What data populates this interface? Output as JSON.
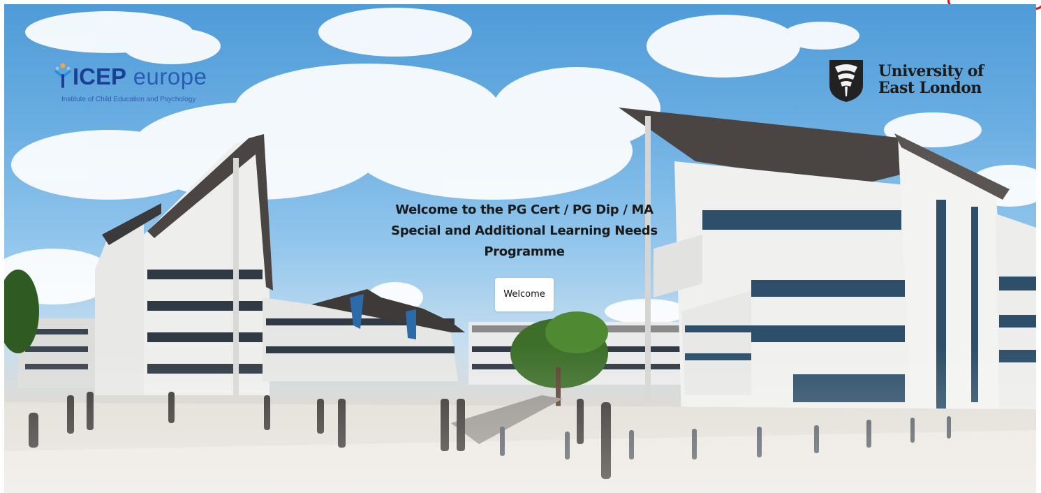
{
  "hero": {
    "title": "Welcome to the PG Cert / PG Dip / MA Special and Additional Learning Needs Programme",
    "button_label": "Welcome",
    "background_image": "university-campus-panorama"
  },
  "logos": {
    "icep": {
      "name_bold": "ICEP",
      "name_light": " europe",
      "tagline": "Institute of Child Education and Psychology",
      "icon": "icep-figure-icon",
      "color": "#1c3f95"
    },
    "uel": {
      "name_line1": "University of",
      "name_line2": "East London",
      "icon": "uel-crest-icon"
    }
  },
  "colors": {
    "accent_outline": "#e4121d",
    "button_background": "#ffffff",
    "title_text": "#1a1a1a"
  }
}
